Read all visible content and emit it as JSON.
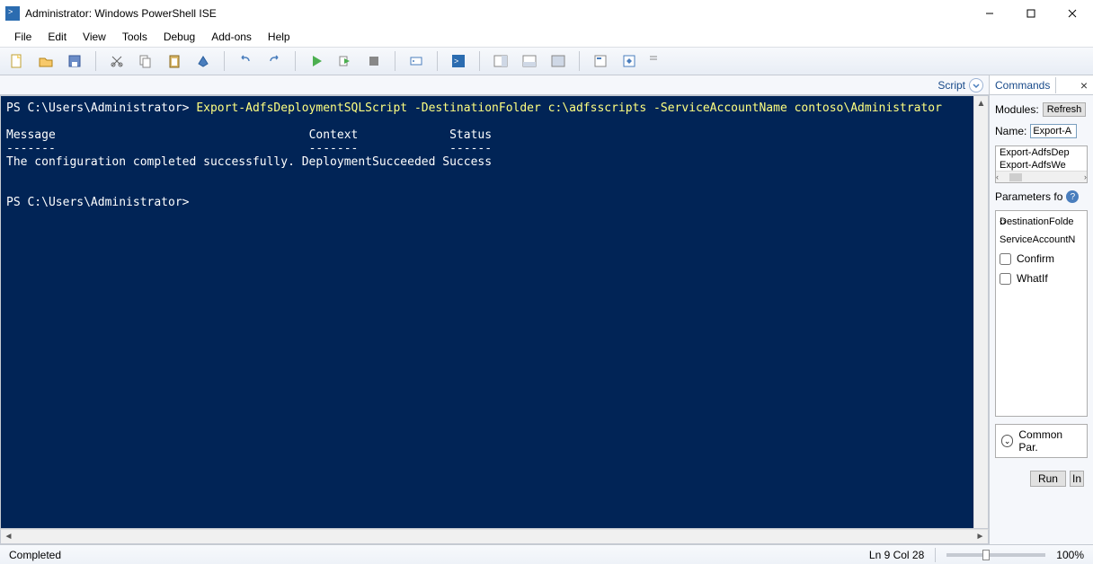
{
  "window": {
    "title": "Administrator: Windows PowerShell ISE"
  },
  "menus": [
    "File",
    "Edit",
    "View",
    "Tools",
    "Debug",
    "Add-ons",
    "Help"
  ],
  "tabs": {
    "script_label": "Script"
  },
  "console": {
    "line1_prompt": "PS C:\\Users\\Administrator> ",
    "line1_cmd": "Export-AdfsDeploymentSQLScript -DestinationFolder c:\\adfsscripts -ServiceAccountName contoso\\Administrator",
    "blank": "",
    "hdr_message": "Message",
    "hdr_context": "Context",
    "hdr_status": "Status",
    "dash_message": "-------",
    "dash_context": "-------",
    "dash_status": "------",
    "result_message": "The configuration completed successfully.",
    "result_context": "DeploymentSucceeded",
    "result_status": "Success",
    "prompt2": "PS C:\\Users\\Administrator>"
  },
  "commands_pane": {
    "tab_label": "Commands",
    "modules_label": "Modules:",
    "refresh_btn": "Refresh",
    "name_label": "Name:",
    "name_value": "Export-A",
    "list": [
      "Export-AdfsDep",
      "Export-AdfsWe"
    ],
    "parameters_label": "Parameters fo",
    "params": [
      "DestinationFolde",
      "ServiceAccountN"
    ],
    "checkboxes": [
      "Confirm",
      "WhatIf"
    ],
    "common_label": "Common Par.",
    "run_btn": "Run",
    "insert_btn": "In"
  },
  "status": {
    "left": "Completed",
    "pos": "Ln 9  Col 28",
    "zoom": "100%"
  }
}
